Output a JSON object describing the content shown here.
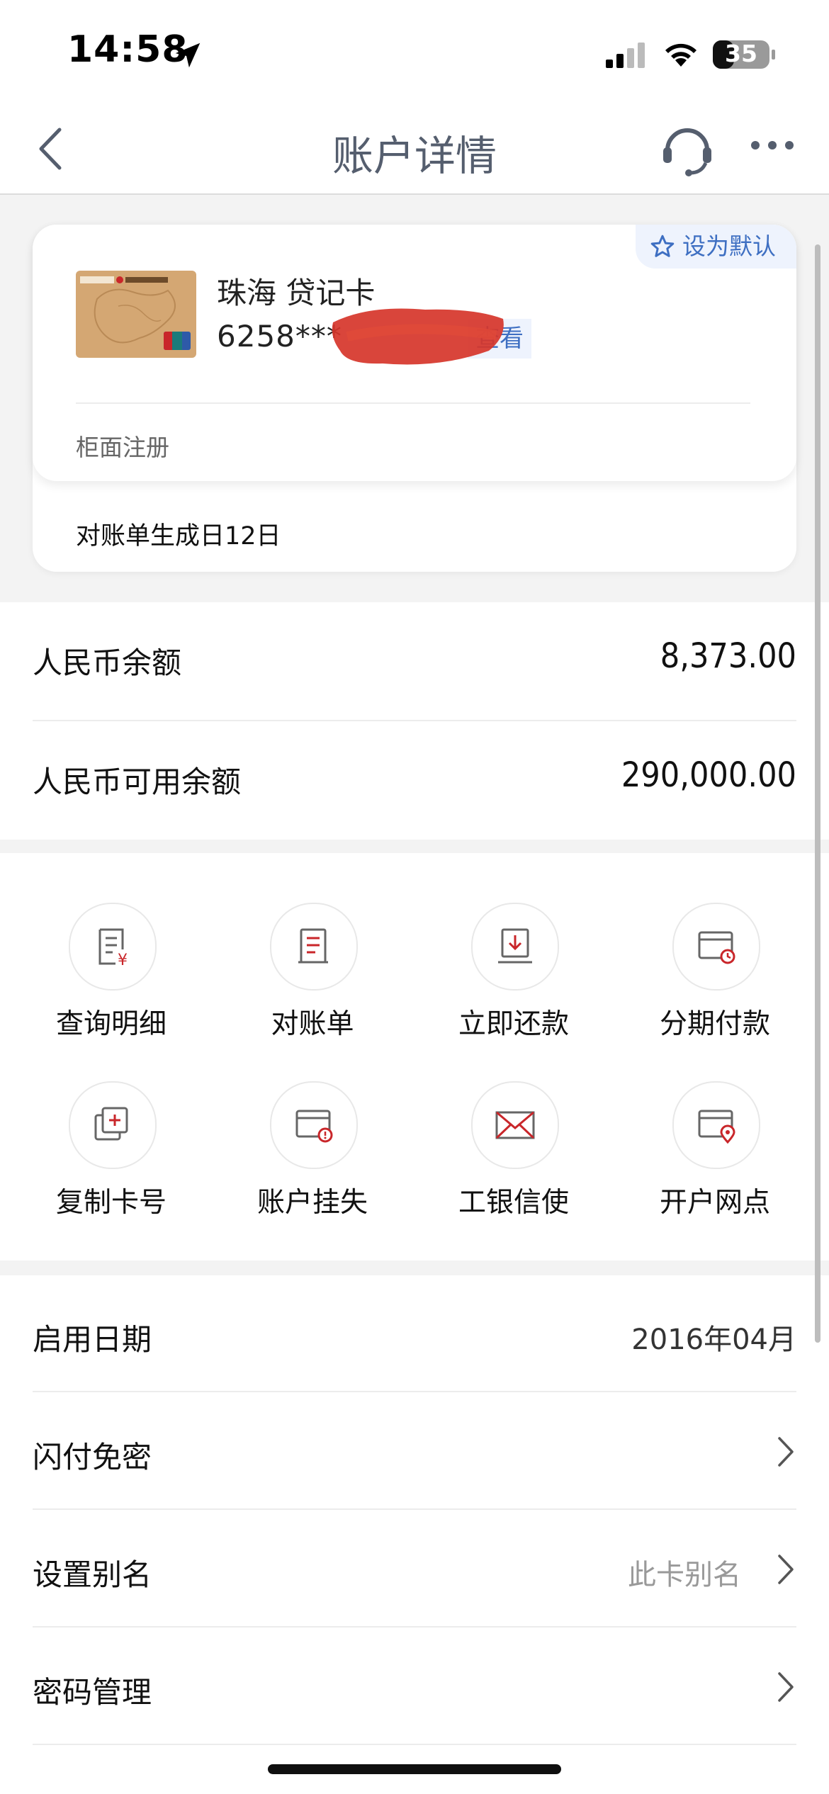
{
  "status_bar": {
    "time": "14:58",
    "battery": "35"
  },
  "nav": {
    "title": "账户详情"
  },
  "card": {
    "name": "珠海 贷记卡",
    "number": "6258***",
    "view_label": "查看",
    "default_label": "设为默认",
    "registration": "柜面注册",
    "statement_day": "对账单生成日12日"
  },
  "balances": [
    {
      "label": "人民币余额",
      "value": "8,373.00"
    },
    {
      "label": "人民币可用余额",
      "value": "290,000.00"
    }
  ],
  "functions": [
    {
      "label": "查询明细",
      "icon": "query-detail-icon"
    },
    {
      "label": "对账单",
      "icon": "statement-icon"
    },
    {
      "label": "立即还款",
      "icon": "repay-icon"
    },
    {
      "label": "分期付款",
      "icon": "installment-icon"
    },
    {
      "label": "复制卡号",
      "icon": "copy-icon"
    },
    {
      "label": "账户挂失",
      "icon": "report-loss-icon"
    },
    {
      "label": "工银信使",
      "icon": "mail-icon"
    },
    {
      "label": "开户网点",
      "icon": "branch-location-icon"
    }
  ],
  "list": [
    {
      "label": "启用日期",
      "value": "2016年04月"
    },
    {
      "label": "闪付免密"
    },
    {
      "label": "设置别名",
      "hint": "此卡别名"
    },
    {
      "label": "密码管理"
    }
  ],
  "colors": {
    "accent_blue": "#3e6fc2",
    "icon_red": "#c9262a",
    "icon_gray": "#666666"
  }
}
